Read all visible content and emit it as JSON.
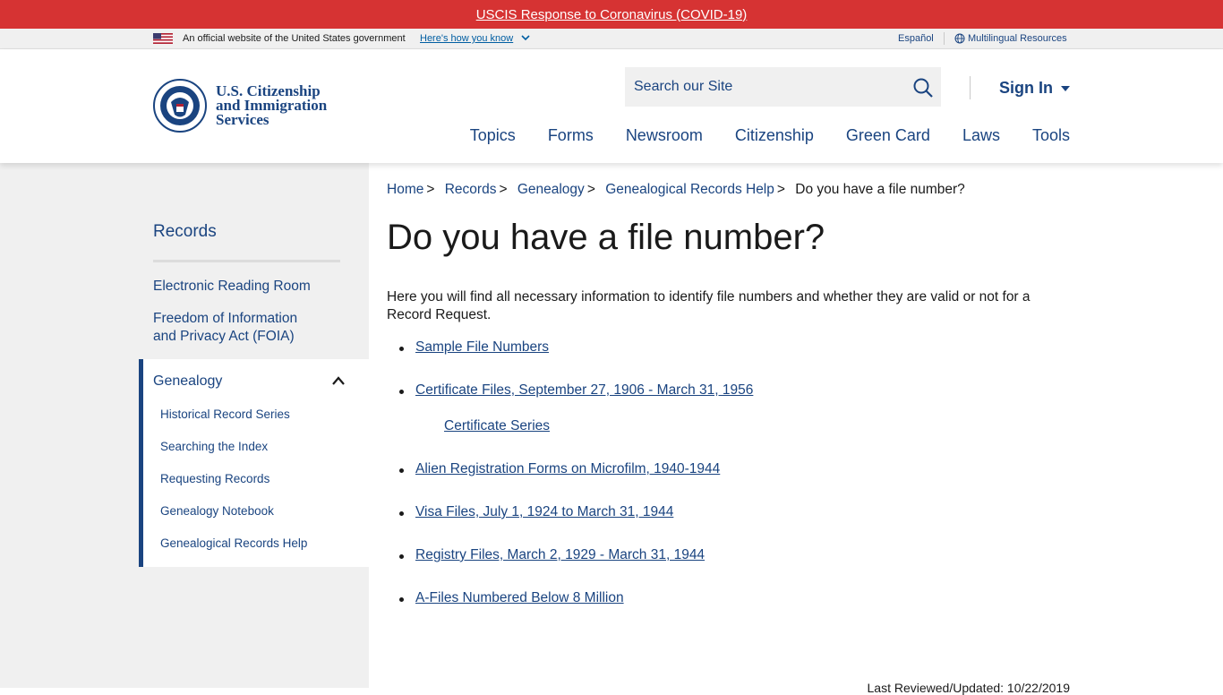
{
  "alert": {
    "label": "USCIS Response to Coronavirus (COVID-19)"
  },
  "govbar": {
    "official": "An official website of the United States government",
    "how": "Here's how you know",
    "espanol": "Español",
    "multilingual": "Multilingual Resources"
  },
  "header": {
    "logo_line1": "U.S. Citizenship",
    "logo_line2": "and Immigration",
    "logo_line3": "Services",
    "search_placeholder": "Search our Site",
    "signin": "Sign In",
    "nav": [
      "Topics",
      "Forms",
      "Newsroom",
      "Citizenship",
      "Green Card",
      "Laws",
      "Tools"
    ]
  },
  "sidebar": {
    "title": "Records",
    "links": [
      "Electronic Reading Room",
      "Freedom of Information",
      "and Privacy Act (FOIA)"
    ],
    "active": "Genealogy",
    "subitems": [
      "Historical Record Series",
      "Searching the Index",
      "Requesting Records",
      "Genealogy Notebook",
      "Genealogical Records Help"
    ]
  },
  "breadcrumb": {
    "items": [
      "Home",
      "Records",
      "Genealogy",
      "Genealogical Records Help"
    ],
    "current": "Do you have a file number?"
  },
  "page": {
    "title": "Do you have a file number?",
    "intro": "Here you will find all necessary information to identify file numbers and whether they are valid or not for a Record Request.",
    "links": [
      "Sample File Numbers",
      "Certificate Files, September 27, 1906 - March 31, 1956",
      "Certificate Series",
      "Alien Registration Forms on Microfilm, 1940-1944 ",
      "Visa Files, July 1, 1924 to March 31, 1944",
      "Registry Files, March 2, 1929 - March 31, 1944 ",
      "A-Files Numbered Below 8 Million"
    ],
    "last_reviewed": "Last Reviewed/Updated: 10/22/2019"
  },
  "colors": {
    "alert": "#d63333",
    "link": "#1a4480",
    "sidebar_bg": "#f0f0f0"
  }
}
